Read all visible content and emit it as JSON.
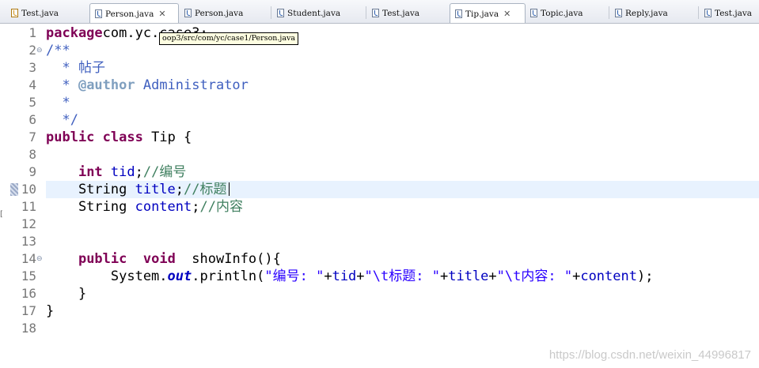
{
  "tabs": [
    {
      "label": "Test.java",
      "icon": "java-file-warning-icon",
      "active": false,
      "close": ""
    },
    {
      "label": "Person.java",
      "icon": "java-file-icon",
      "active": true,
      "close": "✕"
    },
    {
      "label": "Person.java",
      "icon": "java-file-icon",
      "active": false,
      "close": ""
    },
    {
      "label": "Student.java",
      "icon": "java-file-icon",
      "active": false,
      "close": ""
    },
    {
      "label": "Test.java",
      "icon": "java-file-icon",
      "active": false,
      "close": ""
    },
    {
      "label": "Tip.java",
      "icon": "java-file-icon",
      "active": true,
      "close": "✕"
    },
    {
      "label": "Topic.java",
      "icon": "java-file-icon",
      "active": false,
      "close": ""
    },
    {
      "label": "Reply.java",
      "icon": "java-file-icon",
      "active": false,
      "close": ""
    },
    {
      "label": "Test.java",
      "icon": "java-file-icon",
      "active": false,
      "close": ""
    }
  ],
  "tooltip": "oop3/src/com/yc/case1/Person.java",
  "editor": {
    "current_line": 10,
    "lines": [
      {
        "n": "1",
        "fold": "",
        "parts": [
          [
            "kw",
            "package"
          ],
          [
            "",
            "com.yc.case3;"
          ]
        ]
      },
      {
        "n": "2",
        "fold": "⊖",
        "parts": [
          [
            "jd",
            "/**"
          ]
        ]
      },
      {
        "n": "3",
        "fold": "",
        "parts": [
          [
            "jd",
            "  * 帖子"
          ]
        ]
      },
      {
        "n": "4",
        "fold": "",
        "parts": [
          [
            "jd",
            "  * "
          ],
          [
            "jdtag",
            "@author"
          ],
          [
            "jd",
            " Administrator"
          ]
        ]
      },
      {
        "n": "5",
        "fold": "",
        "parts": [
          [
            "jd",
            "  *"
          ]
        ]
      },
      {
        "n": "6",
        "fold": "",
        "parts": [
          [
            "jd",
            "  */"
          ]
        ]
      },
      {
        "n": "7",
        "fold": "",
        "parts": [
          [
            "kw",
            "public"
          ],
          [
            "",
            " "
          ],
          [
            "kw",
            "class"
          ],
          [
            "",
            " Tip {"
          ]
        ]
      },
      {
        "n": "8",
        "fold": "",
        "parts": []
      },
      {
        "n": "9",
        "fold": "",
        "parts": [
          [
            "",
            "    "
          ],
          [
            "kw",
            "int"
          ],
          [
            "",
            " "
          ],
          [
            "fd",
            "tid"
          ],
          [
            "",
            ";"
          ],
          [
            "cm",
            "//编号"
          ]
        ]
      },
      {
        "n": "10",
        "fold": "",
        "parts": [
          [
            "",
            "    String "
          ],
          [
            "fd",
            "title"
          ],
          [
            "",
            ";"
          ],
          [
            "cm",
            "//标题"
          ]
        ]
      },
      {
        "n": "11",
        "fold": "",
        "parts": [
          [
            "",
            "    String "
          ],
          [
            "fd",
            "content"
          ],
          [
            "",
            ";"
          ],
          [
            "cm",
            "//内容"
          ]
        ]
      },
      {
        "n": "12",
        "fold": "",
        "parts": []
      },
      {
        "n": "13",
        "fold": "",
        "parts": []
      },
      {
        "n": "14",
        "fold": "⊖",
        "parts": [
          [
            "",
            "    "
          ],
          [
            "kw",
            "public"
          ],
          [
            "",
            "  "
          ],
          [
            "kw",
            "void"
          ],
          [
            "",
            "  showInfo(){"
          ]
        ]
      },
      {
        "n": "15",
        "fold": "",
        "parts": [
          [
            "",
            "        System."
          ],
          [
            "sf",
            "out"
          ],
          [
            "",
            ".println("
          ],
          [
            "st",
            "\"编号: \""
          ],
          [
            "",
            "+"
          ],
          [
            "fd",
            "tid"
          ],
          [
            "",
            "+"
          ],
          [
            "st",
            "\"\\t标题: \""
          ],
          [
            "",
            "+"
          ],
          [
            "fd",
            "title"
          ],
          [
            "",
            "+"
          ],
          [
            "st",
            "\"\\t内容: \""
          ],
          [
            "",
            "+"
          ],
          [
            "fd",
            "content"
          ],
          [
            "",
            ");"
          ]
        ]
      },
      {
        "n": "16",
        "fold": "",
        "parts": [
          [
            "",
            "    }"
          ]
        ]
      },
      {
        "n": "17",
        "fold": "",
        "parts": [
          [
            "",
            "}"
          ]
        ]
      },
      {
        "n": "18",
        "fold": "",
        "parts": []
      }
    ]
  },
  "watermark": "https://blog.csdn.net/weixin_44996817"
}
